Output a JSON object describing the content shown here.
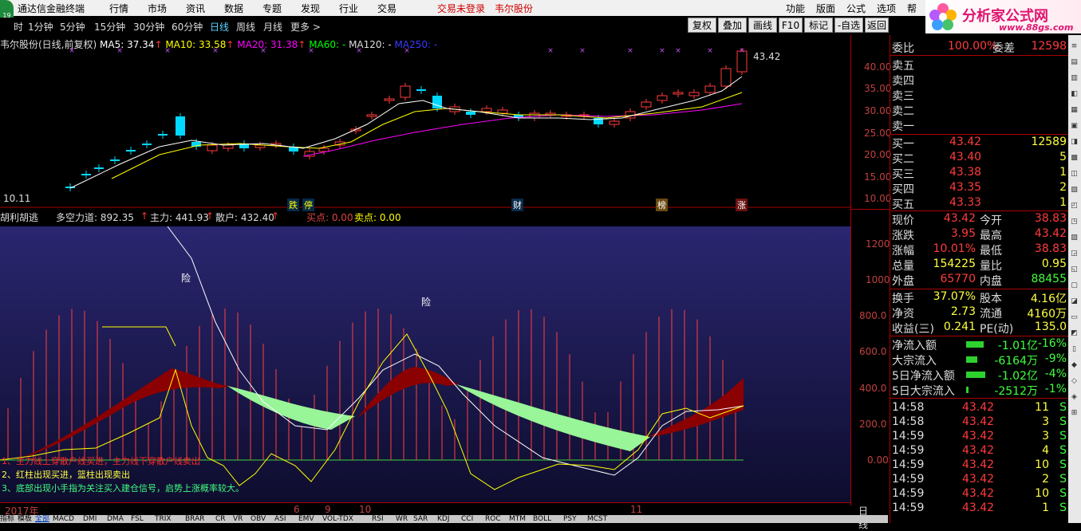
{
  "menubar": {
    "title": "通达信金融终端",
    "items": [
      "行情",
      "市场",
      "资讯",
      "数据",
      "专题",
      "发现",
      "行业",
      "交易"
    ],
    "status": "交易未登录",
    "stock": "韦尔股份",
    "right_items": [
      "功能",
      "版面",
      "公式",
      "选项",
      "帮"
    ]
  },
  "logo": {
    "name": "分析家公式网",
    "url": "www.88gs.com"
  },
  "periods": [
    "时",
    "1分钟",
    "5分钟",
    "15分钟",
    "30分钟",
    "60分钟",
    "日线",
    "周线",
    "月线",
    "更多 >"
  ],
  "active_period": "日线",
  "toolbar": [
    "复权",
    "叠加",
    "画线",
    "F10",
    "标记",
    "-自选",
    "返回"
  ],
  "main": {
    "title": "韦尔股份(日线,前复权)",
    "ma5": "MA5: 37.34",
    "ma10": "MA10: 33.58",
    "ma20": "MA20: 31.38",
    "ma60": "MA60: -",
    "ma120": "MA120: -",
    "ma250": "MA250: -",
    "high_label": "43.42",
    "low_label": "10.11",
    "y_ticks": [
      "40.00",
      "35.00",
      "30.00",
      "25.00",
      "20.00",
      "15.00",
      "10.00"
    ],
    "event_tags": [
      "跌",
      "停",
      "财",
      "榜",
      "涨"
    ],
    "colors": {
      "up": "#ff3b3b",
      "down": "#00d8ff",
      "ma5": "#ffffff",
      "ma10": "#ffff00",
      "ma20": "#ff00ff"
    }
  },
  "sub": {
    "name": "胡利胡逃",
    "dkld": "多空力道: 892.35",
    "zhuli": "主力: 441.93",
    "sanhu": "散户: 432.40",
    "buy": "买点: 0.00",
    "sell": "卖点: 0.00",
    "hints": [
      "1、主力线上穿散户线买进，主力线下穿散户线卖出",
      "2、红柱出现买进，篮柱出现卖出",
      "3、底部出现小手指为关注买入建仓信号，启势上涨概率较大。"
    ],
    "risk_label": "险",
    "y_ticks": [
      "1200",
      "1000",
      "800.0",
      "600.0",
      "400.0",
      "200.0",
      "0.00"
    ]
  },
  "dates": [
    "2017年",
    "6",
    "9",
    "10",
    "11"
  ],
  "date_axis_label": "日线",
  "bottom_tabs": [
    "指标",
    "模板",
    "全部",
    "MACD",
    "DMI",
    "DMA",
    "FSL",
    "TRIX",
    "BRAR",
    "CR",
    "VR",
    "OBV",
    "ASI",
    "EMV",
    "VOL-TDX",
    "RSI",
    "WR",
    "SAR",
    "KDJ",
    "CCI",
    "ROC",
    "MTM",
    "BOLL",
    "PSY",
    "MCST"
  ],
  "quote": {
    "weibi_label": "委比",
    "weibi": "100.00%",
    "weicha_label": "委差",
    "weicha": "12598",
    "sells": [
      "卖五",
      "卖四",
      "卖三",
      "卖二",
      "卖一"
    ],
    "buys": [
      {
        "label": "买一",
        "price": "43.42",
        "vol": "12589"
      },
      {
        "label": "买二",
        "price": "43.40",
        "vol": "5"
      },
      {
        "label": "买三",
        "price": "43.38",
        "vol": "1"
      },
      {
        "label": "买四",
        "price": "43.35",
        "vol": "2"
      },
      {
        "label": "买五",
        "price": "43.33",
        "vol": "1"
      }
    ],
    "stats": [
      {
        "l1": "现价",
        "v1": "43.42",
        "l2": "今开",
        "v2": "38.83"
      },
      {
        "l1": "涨跌",
        "v1": "3.95",
        "l2": "最高",
        "v2": "43.42"
      },
      {
        "l1": "涨幅",
        "v1": "10.01%",
        "l2": "最低",
        "v2": "38.83"
      },
      {
        "l1": "总量",
        "v1": "154225",
        "l2": "量比",
        "v2": "0.95"
      },
      {
        "l1": "外盘",
        "v1": "65770",
        "l2": "内盘",
        "v2": "88455"
      }
    ],
    "stats2": [
      {
        "l1": "换手",
        "v1": "37.07%",
        "l2": "股本",
        "v2": "4.16亿"
      },
      {
        "l1": "净资",
        "v1": "2.73",
        "l2": "流通",
        "v2": "4160万"
      },
      {
        "l1": "收益(三)",
        "v1": "0.241",
        "l2": "PE(动)",
        "v2": "135.0"
      }
    ],
    "flows": [
      {
        "label": "净流入额",
        "value": "-1.01亿",
        "pct": "-16%",
        "bar": 0.9
      },
      {
        "label": "大宗流入",
        "value": "-6164万",
        "pct": "-9%",
        "bar": 0.6
      },
      {
        "label": "5日净流入额",
        "value": "-1.02亿",
        "pct": "-4%",
        "bar": 1.0
      },
      {
        "label": "5日大宗流入",
        "value": "-2512万",
        "pct": "-1%",
        "bar": 0.1
      }
    ],
    "ticks": [
      {
        "t": "14:58",
        "p": "43.42",
        "v": "11",
        "s": "S"
      },
      {
        "t": "14:58",
        "p": "43.42",
        "v": "3",
        "s": "S"
      },
      {
        "t": "14:59",
        "p": "43.42",
        "v": "3",
        "s": "S"
      },
      {
        "t": "14:59",
        "p": "43.42",
        "v": "4",
        "s": "S"
      },
      {
        "t": "14:59",
        "p": "43.42",
        "v": "10",
        "s": "S"
      },
      {
        "t": "14:59",
        "p": "43.42",
        "v": "2",
        "s": "S"
      },
      {
        "t": "14:59",
        "p": "43.42",
        "v": "10",
        "s": "S"
      },
      {
        "t": "14:59",
        "p": "43.42",
        "v": "1",
        "s": "S"
      }
    ]
  }
}
